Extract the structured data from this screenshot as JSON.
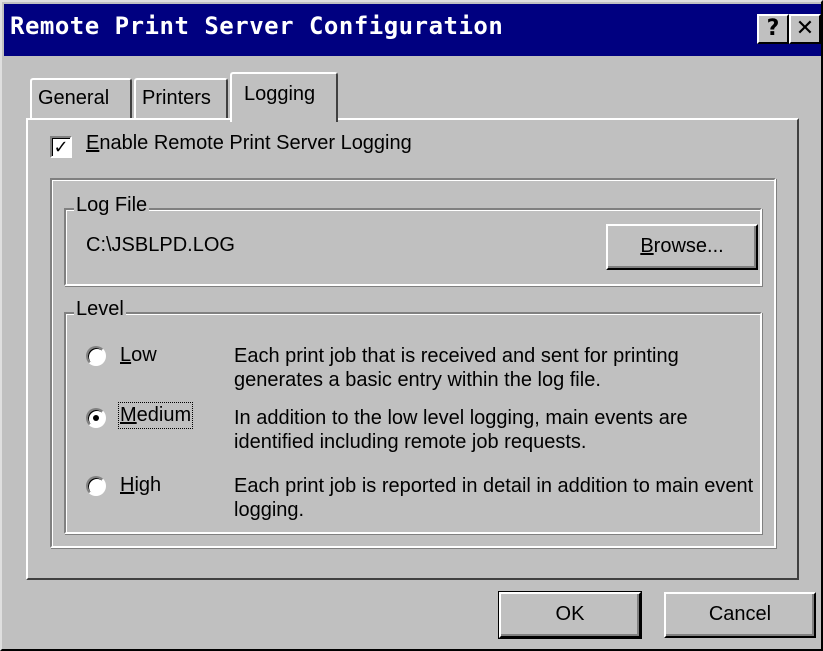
{
  "window": {
    "title": "Remote Print Server Configuration",
    "help_button": "?",
    "close_button": "✕"
  },
  "tabs": [
    {
      "label": "General",
      "selected": false
    },
    {
      "label": "Printers",
      "selected": false
    },
    {
      "label": "Logging",
      "selected": true
    }
  ],
  "logging": {
    "enable_checkbox": {
      "checked": true,
      "mark": "✓",
      "label_mnemonic": "E",
      "label_rest": "nable Remote Print Server Logging"
    },
    "log_file": {
      "group_title": "Log File",
      "path": "C:\\JSBLPD.LOG",
      "browse_mnemonic": "B",
      "browse_rest": "rowse..."
    },
    "level": {
      "group_title": "Level",
      "options": [
        {
          "mnemonic": "L",
          "label_rest": "ow",
          "selected": false,
          "description": "Each print job that is received and sent for printing generates a basic entry within the log file."
        },
        {
          "mnemonic": "M",
          "label_rest": "edium",
          "selected": true,
          "description": "In addition to the low level logging, main events are identified including remote job requests."
        },
        {
          "mnemonic": "H",
          "label_rest": "igh",
          "selected": false,
          "description": "Each print job is reported in detail in addition to main event logging."
        }
      ]
    }
  },
  "buttons": {
    "ok": "OK",
    "cancel": "Cancel"
  },
  "colors": {
    "title_bar": "#000080",
    "face": "#c0c0c0"
  }
}
